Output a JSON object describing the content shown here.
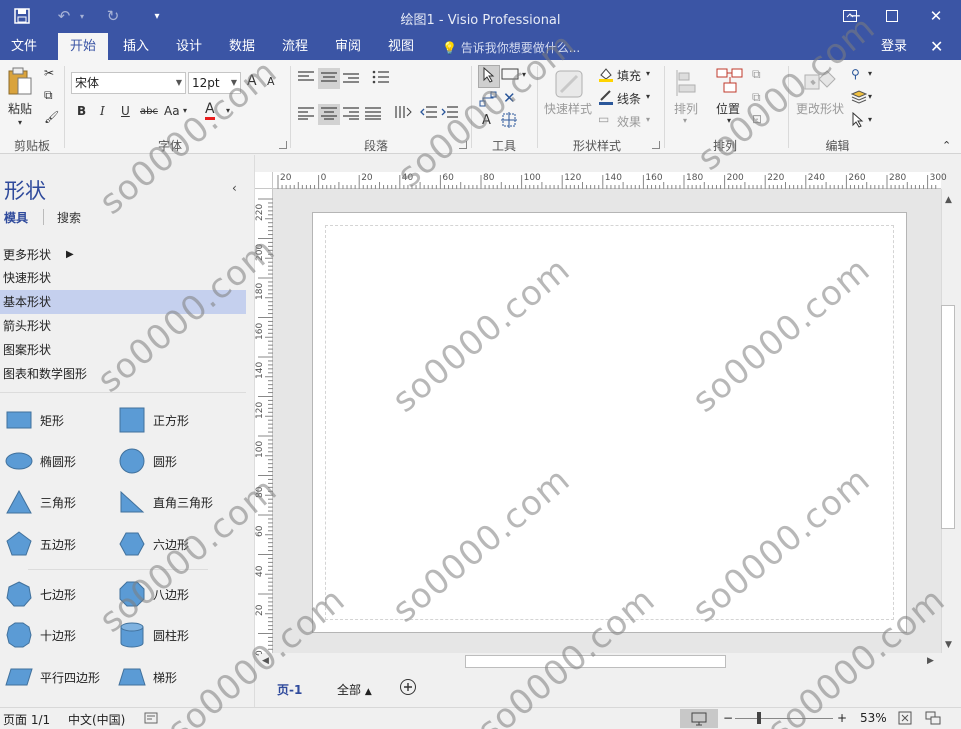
{
  "window": {
    "title": "绘图1 - Visio Professional"
  },
  "tabs": [
    "文件",
    "开始",
    "插入",
    "设计",
    "数据",
    "流程",
    "审阅",
    "视图"
  ],
  "active_tab": "开始",
  "tell_me": "告诉我你想要做什么...",
  "login": "登录",
  "ribbon": {
    "clipboard": {
      "paste": "粘贴",
      "label": "剪贴板"
    },
    "font": {
      "name": "宋体",
      "size": "12pt",
      "bold": "B",
      "italic": "I",
      "underline": "U",
      "strike": "abc",
      "case": "Aa",
      "color_a": "A",
      "grow": "A",
      "shrink": "A",
      "label": "字体"
    },
    "paragraph": {
      "label": "段落"
    },
    "tools": {
      "text_tool": "A",
      "label": "工具"
    },
    "shape_style": {
      "quick_styles": "快速样式",
      "fill": "填充",
      "line": "线条",
      "effects": "效果",
      "label": "形状样式"
    },
    "arrange": {
      "arrange": "排列",
      "position": "位置",
      "label": "排列"
    },
    "edit": {
      "change_shape": "更改形状",
      "label": "编辑"
    }
  },
  "shapes_pane": {
    "title": "形状",
    "tabs": [
      "模具",
      "搜索"
    ],
    "stencils": [
      "更多形状",
      "快速形状",
      "基本形状",
      "箭头形状",
      "图案形状",
      "图表和数学图形"
    ],
    "selected_stencil": "基本形状",
    "shapes": [
      "矩形",
      "正方形",
      "椭圆形",
      "圆形",
      "三角形",
      "直角三角形",
      "五边形",
      "六边形",
      "七边形",
      "八边形",
      "十边形",
      "圆柱形",
      "平行四边形",
      "梯形"
    ]
  },
  "ruler": {
    "top_ticks": [
      "20",
      "0",
      "20",
      "40",
      "60",
      "80",
      "100",
      "120",
      "140",
      "160",
      "180",
      "200",
      "220",
      "240",
      "260",
      "280",
      "300"
    ],
    "left_ticks": [
      "220",
      "200",
      "180",
      "160",
      "140",
      "120",
      "100",
      "80",
      "60",
      "40",
      "20",
      "0"
    ]
  },
  "page_tabs": {
    "page": "页-1",
    "all": "全部",
    "all_arrow": "▲"
  },
  "status": {
    "page_info": "页面 1/1",
    "language": "中文(中国)",
    "zoom": "53%"
  },
  "watermark": "so0000.com",
  "colors": {
    "title_bar": "#3b55a5",
    "shape_fill": "#5b9bd5",
    "selected_stencil": "#c5d0ee"
  }
}
